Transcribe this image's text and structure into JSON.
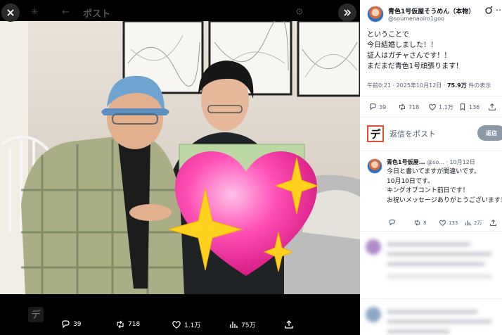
{
  "viewer": {
    "header_faded_text": "ポスト",
    "actions": {
      "replies": "39",
      "reposts": "718",
      "likes": "1.1万",
      "views": "75万"
    }
  },
  "post": {
    "author_name": "青色1号仮屋そうめん（本物）",
    "author_handle": "@soumenaoiro1goo",
    "text_lines": [
      "ということで",
      "今日結婚しました！！",
      "証人はガチャさんです！！",
      "まだまだ青色1号頑張ります！"
    ],
    "meta_time": "午前0:21 · 2025年10月12日 · ",
    "meta_views_value": "75.9万",
    "meta_views_label": " 件の表示",
    "stats": {
      "replies": "39",
      "reposts": "718",
      "likes": "1.1万",
      "bookmarks": "136"
    }
  },
  "reply_box": {
    "placeholder": "返信をポスト",
    "button_label": "返信"
  },
  "reply": {
    "author_name": "青色1号仮屋...",
    "author_handle": "@so... · 10月12日",
    "text_lines": [
      "今日と書いてますが間違いです。",
      "10月10日です。",
      "キングオブコント前日です！",
      "お祝いメッセージありがとうございます！"
    ],
    "stats": {
      "reposts": "8",
      "likes": "133",
      "views": "2万"
    }
  },
  "colors": {
    "accent_gray": "#8b98a5",
    "reply_glyph_border": "#e0502f",
    "heart_pink": "#ff4fb5",
    "sparkle_yellow": "#ffd21f"
  }
}
